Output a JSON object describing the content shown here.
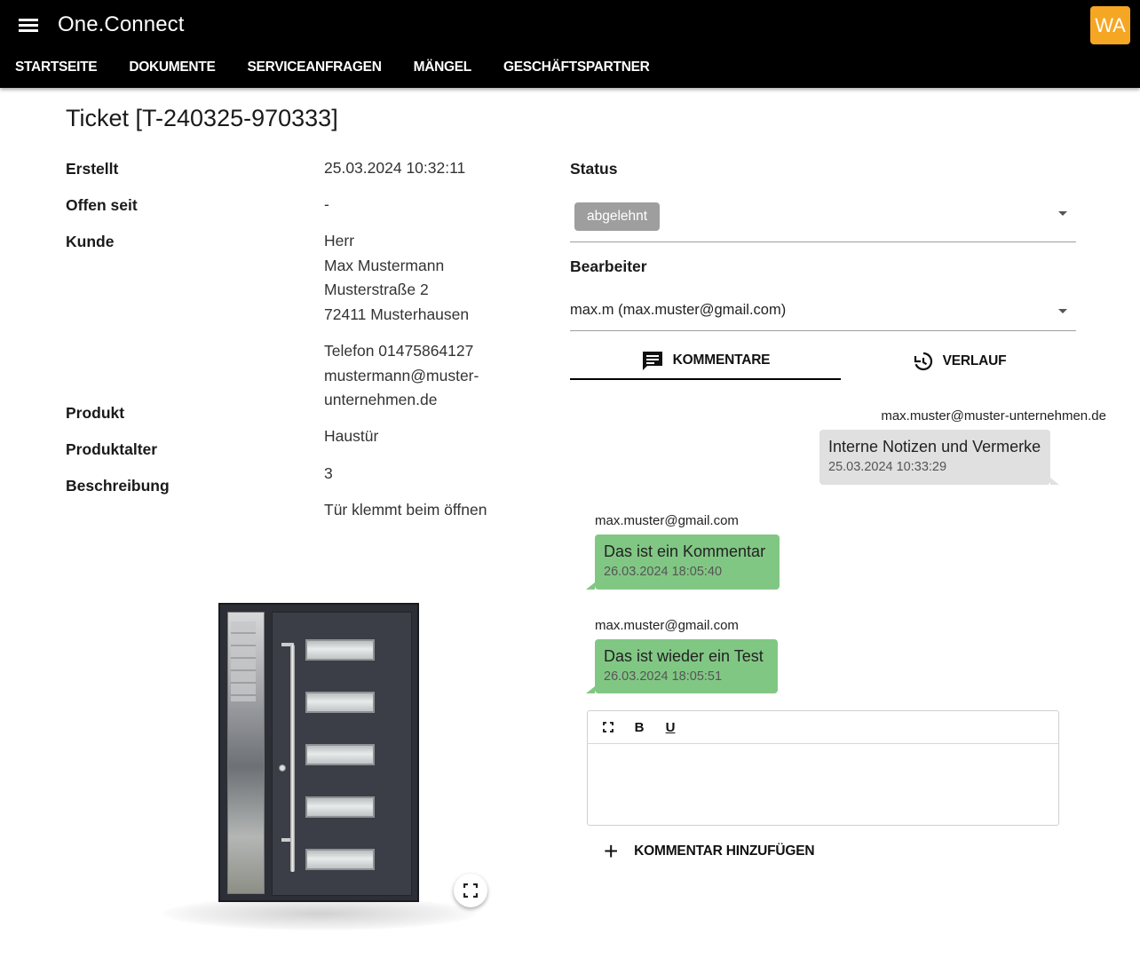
{
  "app": {
    "title": "One.Connect",
    "avatar_initials": "WA",
    "avatar_color": "#f5a623",
    "nav": [
      {
        "label": "STARTSEITE"
      },
      {
        "label": "DOKUMENTE"
      },
      {
        "label": "SERVICEANFRAGEN"
      },
      {
        "label": "MÄNGEL"
      },
      {
        "label": "GESCHÄFTSPARTNER"
      }
    ]
  },
  "ticket": {
    "title": "Ticket [T-240325-970333]",
    "labels": {
      "created": "Erstellt",
      "open_since": "Offen seit",
      "customer": "Kunde",
      "product": "Produkt",
      "product_age": "Produktalter",
      "description": "Beschreibung"
    },
    "created": "25.03.2024 10:32:11",
    "open_since": "-",
    "customer": {
      "salutation": "Herr",
      "name": "Max Mustermann",
      "street": "Musterstraße 2",
      "city": "72411 Musterhausen",
      "phone": "Telefon 01475864127",
      "email_line1": "mustermann@muster-",
      "email_line2": "unternehmen.de"
    },
    "product": "Haustür",
    "product_age": "3",
    "description": "Tür klemmt beim öffnen"
  },
  "status": {
    "label": "Status",
    "value": "abgelehnt",
    "chip_color": "#9e9e9e"
  },
  "assignee": {
    "label": "Bearbeiter",
    "value": "max.m (max.muster@gmail.com)"
  },
  "tabs": [
    {
      "label": "KOMMENTARE",
      "icon": "comment-icon",
      "active": true
    },
    {
      "label": "VERLAUF",
      "icon": "history-icon",
      "active": false
    }
  ],
  "comments": [
    {
      "author": "max.muster@muster-unternehmen.de",
      "text": "Interne Notizen und Vermerke",
      "timestamp": "25.03.2024 10:33:29",
      "color": "#e0e0e0"
    },
    {
      "author": "max.muster@gmail.com",
      "text": "Das ist ein Kommentar",
      "timestamp": "26.03.2024 18:05:40",
      "color": "#81c784"
    },
    {
      "author": "max.muster@gmail.com",
      "text": "Das ist wieder ein Test",
      "timestamp": "26.03.2024 18:05:51",
      "color": "#81c784"
    }
  ],
  "editor": {
    "toolbar": {
      "fullscreen_icon": "fullscreen-icon",
      "bold": "B",
      "underline": "U"
    },
    "value": ""
  },
  "add_comment_label": "KOMMENTAR HINZUFÜGEN"
}
